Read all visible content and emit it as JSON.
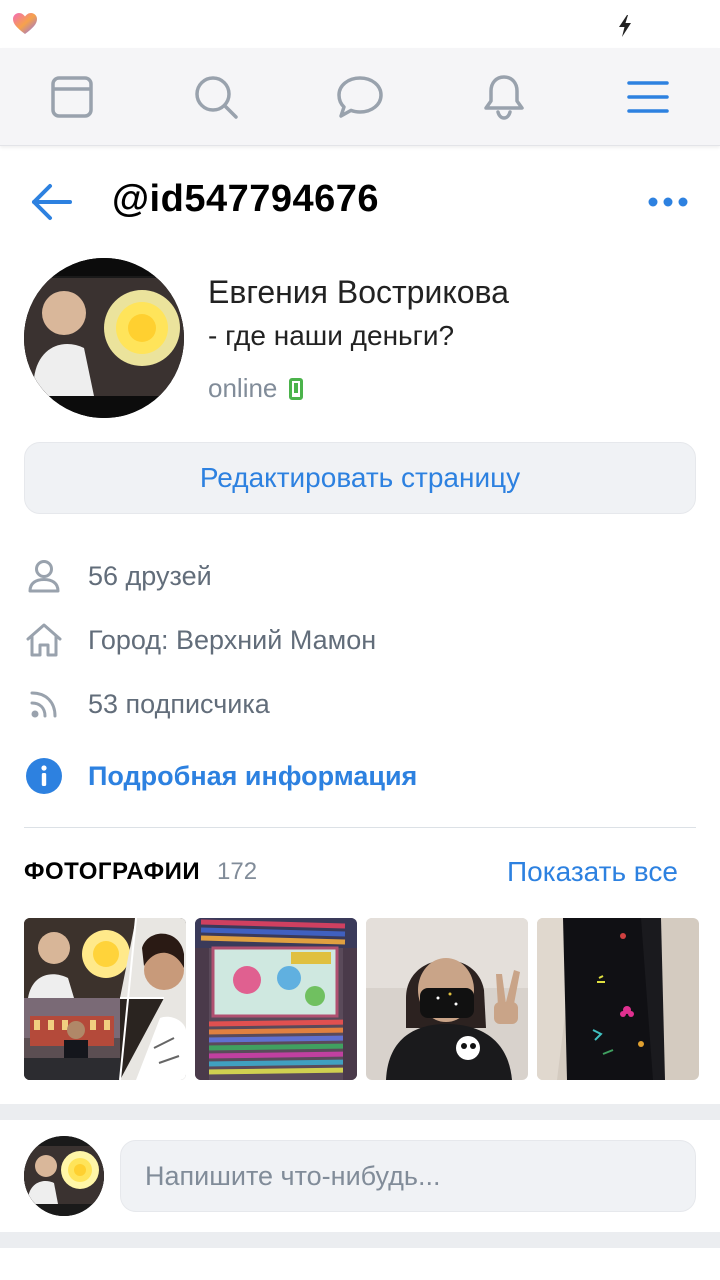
{
  "header": {
    "handle": "@id547794676"
  },
  "profile": {
    "name": "Евгения Вострикова",
    "status": "- где наши деньги?",
    "online": "online",
    "edit_button": "Редактировать страницу"
  },
  "info": {
    "friends": "56 друзей",
    "city": "Город: Верхний Мамон",
    "followers": "53 подписчика",
    "details": "Подробная информация"
  },
  "photos": {
    "title": "ФОТОГРАФИИ",
    "count": "172",
    "show_all": "Показать все"
  },
  "composer": {
    "placeholder": "Напишите что-нибудь..."
  },
  "colors": {
    "accent": "#2d81e0",
    "secondary_text": "#818c99",
    "online": "#4bb34b",
    "nav_icon": "#99a2ad"
  },
  "icons": {
    "nav": [
      "newsfeed-icon",
      "search-icon",
      "messages-icon",
      "notifications-icon",
      "menu-icon"
    ],
    "info": [
      "user-icon",
      "home-icon",
      "rss-icon",
      "info-icon"
    ]
  }
}
